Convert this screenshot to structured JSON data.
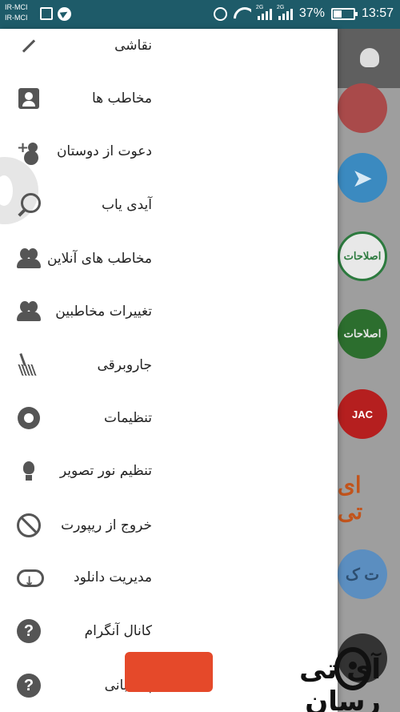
{
  "status_bar": {
    "carrier_1": "IR-MCI",
    "carrier_2": "IR-MCI",
    "network_1": "2G",
    "network_2": "2G",
    "battery": "37%",
    "time": "13:57"
  },
  "drawer": {
    "items": [
      {
        "label": "نقاشی",
        "icon": "brush-icon"
      },
      {
        "label": "مخاطب ها",
        "icon": "contact-icon"
      },
      {
        "label": "دعوت از دوستان",
        "icon": "person-add-icon"
      },
      {
        "label": "آیدی یاب",
        "icon": "search-icon"
      },
      {
        "label": "مخاطب های آنلاین",
        "icon": "people-icon"
      },
      {
        "label": "تغییرات مخاطبین",
        "icon": "people-icon"
      },
      {
        "label": "جاروبرقی",
        "icon": "broom-icon"
      },
      {
        "label": "تنظیمات",
        "icon": "gear-icon"
      },
      {
        "label": "تنظیم نور تصویر",
        "icon": "lightbulb-icon"
      },
      {
        "label": "خروج از ریپورت",
        "icon": "block-icon"
      },
      {
        "label": "مدیریت دانلود",
        "icon": "cloud-download-icon"
      },
      {
        "label": "کانال آنگرام",
        "icon": "help-icon"
      },
      {
        "label": "پشتیبانی",
        "icon": "help-icon"
      }
    ]
  },
  "behind_list": {
    "avatars": [
      "",
      "",
      "اصلاحات",
      "اصلاحات",
      "JAC",
      "ای تی",
      "ت ک",
      ""
    ]
  },
  "watermark": {
    "text": "آی تی رسان",
    "color": "#e5492a"
  },
  "colors": {
    "status_bar": "#1e5b69",
    "icon": "#555555"
  }
}
